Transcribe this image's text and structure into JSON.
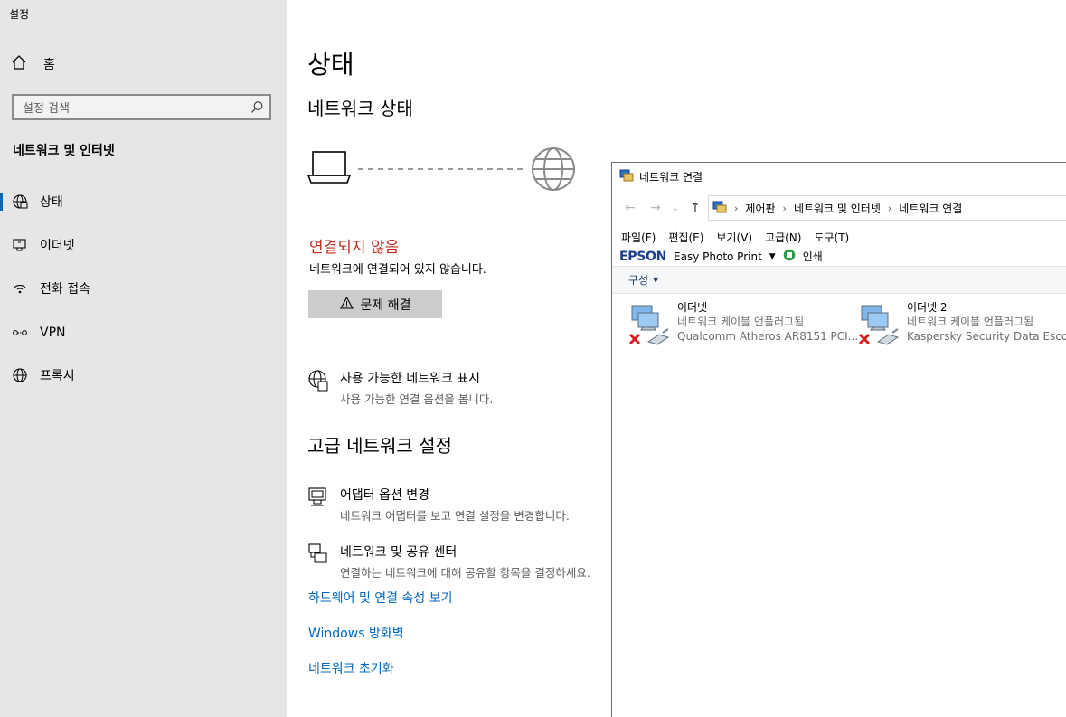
{
  "settings": {
    "app_title": "설정",
    "home_label": "홈",
    "search_placeholder": "설정 검색",
    "section_title": "네트워크 및 인터넷",
    "nav": [
      {
        "label": "상태",
        "icon": "globe-status-icon",
        "selected": true
      },
      {
        "label": "이더넷",
        "icon": "ethernet-icon"
      },
      {
        "label": "전화 접속",
        "icon": "dialup-icon"
      },
      {
        "label": "VPN",
        "icon": "vpn-icon"
      },
      {
        "label": "프록시",
        "icon": "proxy-globe-icon"
      }
    ],
    "page_title": "상태",
    "network_status_heading": "네트워크 상태",
    "status_title": "연결되지 않음",
    "status_desc": "네트워크에 연결되어 있지 않습니다.",
    "troubleshoot_label": "문제 해결",
    "show_networks": {
      "title": "사용 가능한 네트워크 표시",
      "subtitle": "사용 가능한 연결 옵션을 봅니다."
    },
    "advanced_heading": "고급 네트워크 설정",
    "adapter_options": {
      "title": "어댑터 옵션 변경",
      "subtitle": "네트워크 어댑터를 보고 연결 설정을 변경합니다."
    },
    "sharing_center": {
      "title": "네트워크 및 공유 센터",
      "subtitle": "연결하는 네트워크에 대해 공유할 항목을 결정하세요."
    },
    "links": [
      "하드웨어 및 연결 속성 보기",
      "Windows 방화벽",
      "네트워크 초기화"
    ],
    "colors": {
      "sidebar_bg": "#e6e6e6",
      "error": "#c42b1c",
      "link": "#0067c0"
    }
  },
  "explorer": {
    "title": "네트워크 연결",
    "breadcrumb": [
      "제어판",
      "네트워크 및 인터넷",
      "네트워크 연결"
    ],
    "menu": [
      "파일(F)",
      "편집(E)",
      "보기(V)",
      "고급(N)",
      "도구(T)"
    ],
    "epson_brand": "EPSON",
    "epson_app": "Easy Photo Print",
    "print_label": "인쇄",
    "organize_label": "구성",
    "adapters": [
      {
        "name": "이더넷",
        "status": "네트워크 케이블 언플러그됨",
        "device": "Qualcomm Atheros AR8151 PCI..."
      },
      {
        "name": "이더넷 2",
        "status": "네트워크 케이블 언플러그됨",
        "device": "Kaspersky Security Data Escort A"
      }
    ]
  }
}
